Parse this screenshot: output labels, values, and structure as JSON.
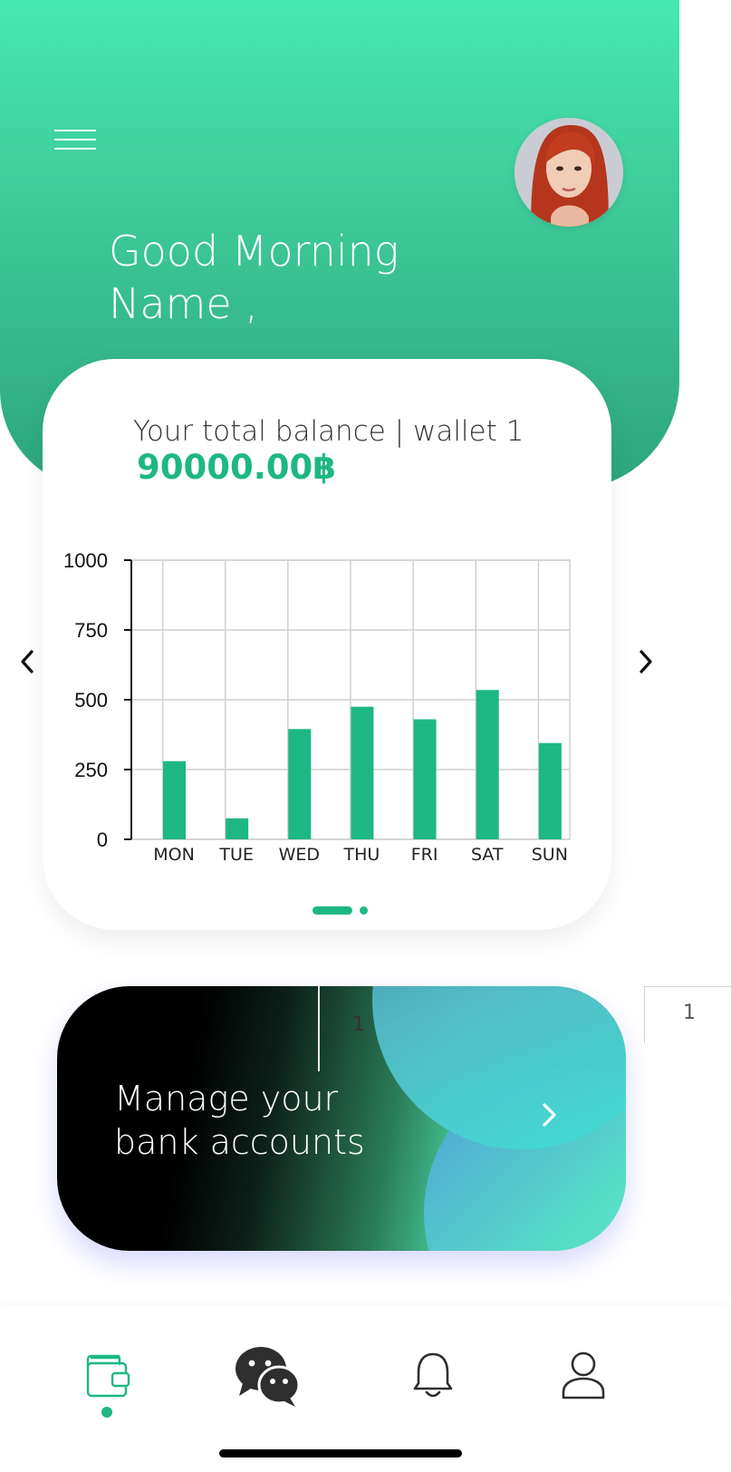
{
  "header": {
    "greeting_line1": "Good Morning",
    "greeting_line2": "Name ,"
  },
  "balance": {
    "label": "Your total balance | wallet 1",
    "amount": "90000.00฿"
  },
  "chart_data": {
    "type": "bar",
    "categories": [
      "MON",
      "TUE",
      "WED",
      "THU",
      "FRI",
      "SAT",
      "SUN"
    ],
    "values": [
      280,
      75,
      395,
      475,
      430,
      535,
      345
    ],
    "yticks": [
      "1000",
      "750",
      "500",
      "250",
      "0"
    ],
    "ylim": [
      0,
      1000
    ],
    "grid": true,
    "bar_color": "#1db784"
  },
  "carousel": {
    "pages": 2,
    "active": 1
  },
  "bank_card": {
    "line1": "Manage your",
    "line2": "bank accounts",
    "ghost_label": "1"
  },
  "side_tab": {
    "label": "1"
  },
  "nav": {
    "items": [
      "wallet-icon",
      "chat-icon",
      "bell-icon",
      "profile-icon"
    ],
    "active": "wallet-icon"
  },
  "colors": {
    "accent": "#1db784",
    "header_top": "#46e8b2",
    "header_bottom": "#2da57e"
  }
}
